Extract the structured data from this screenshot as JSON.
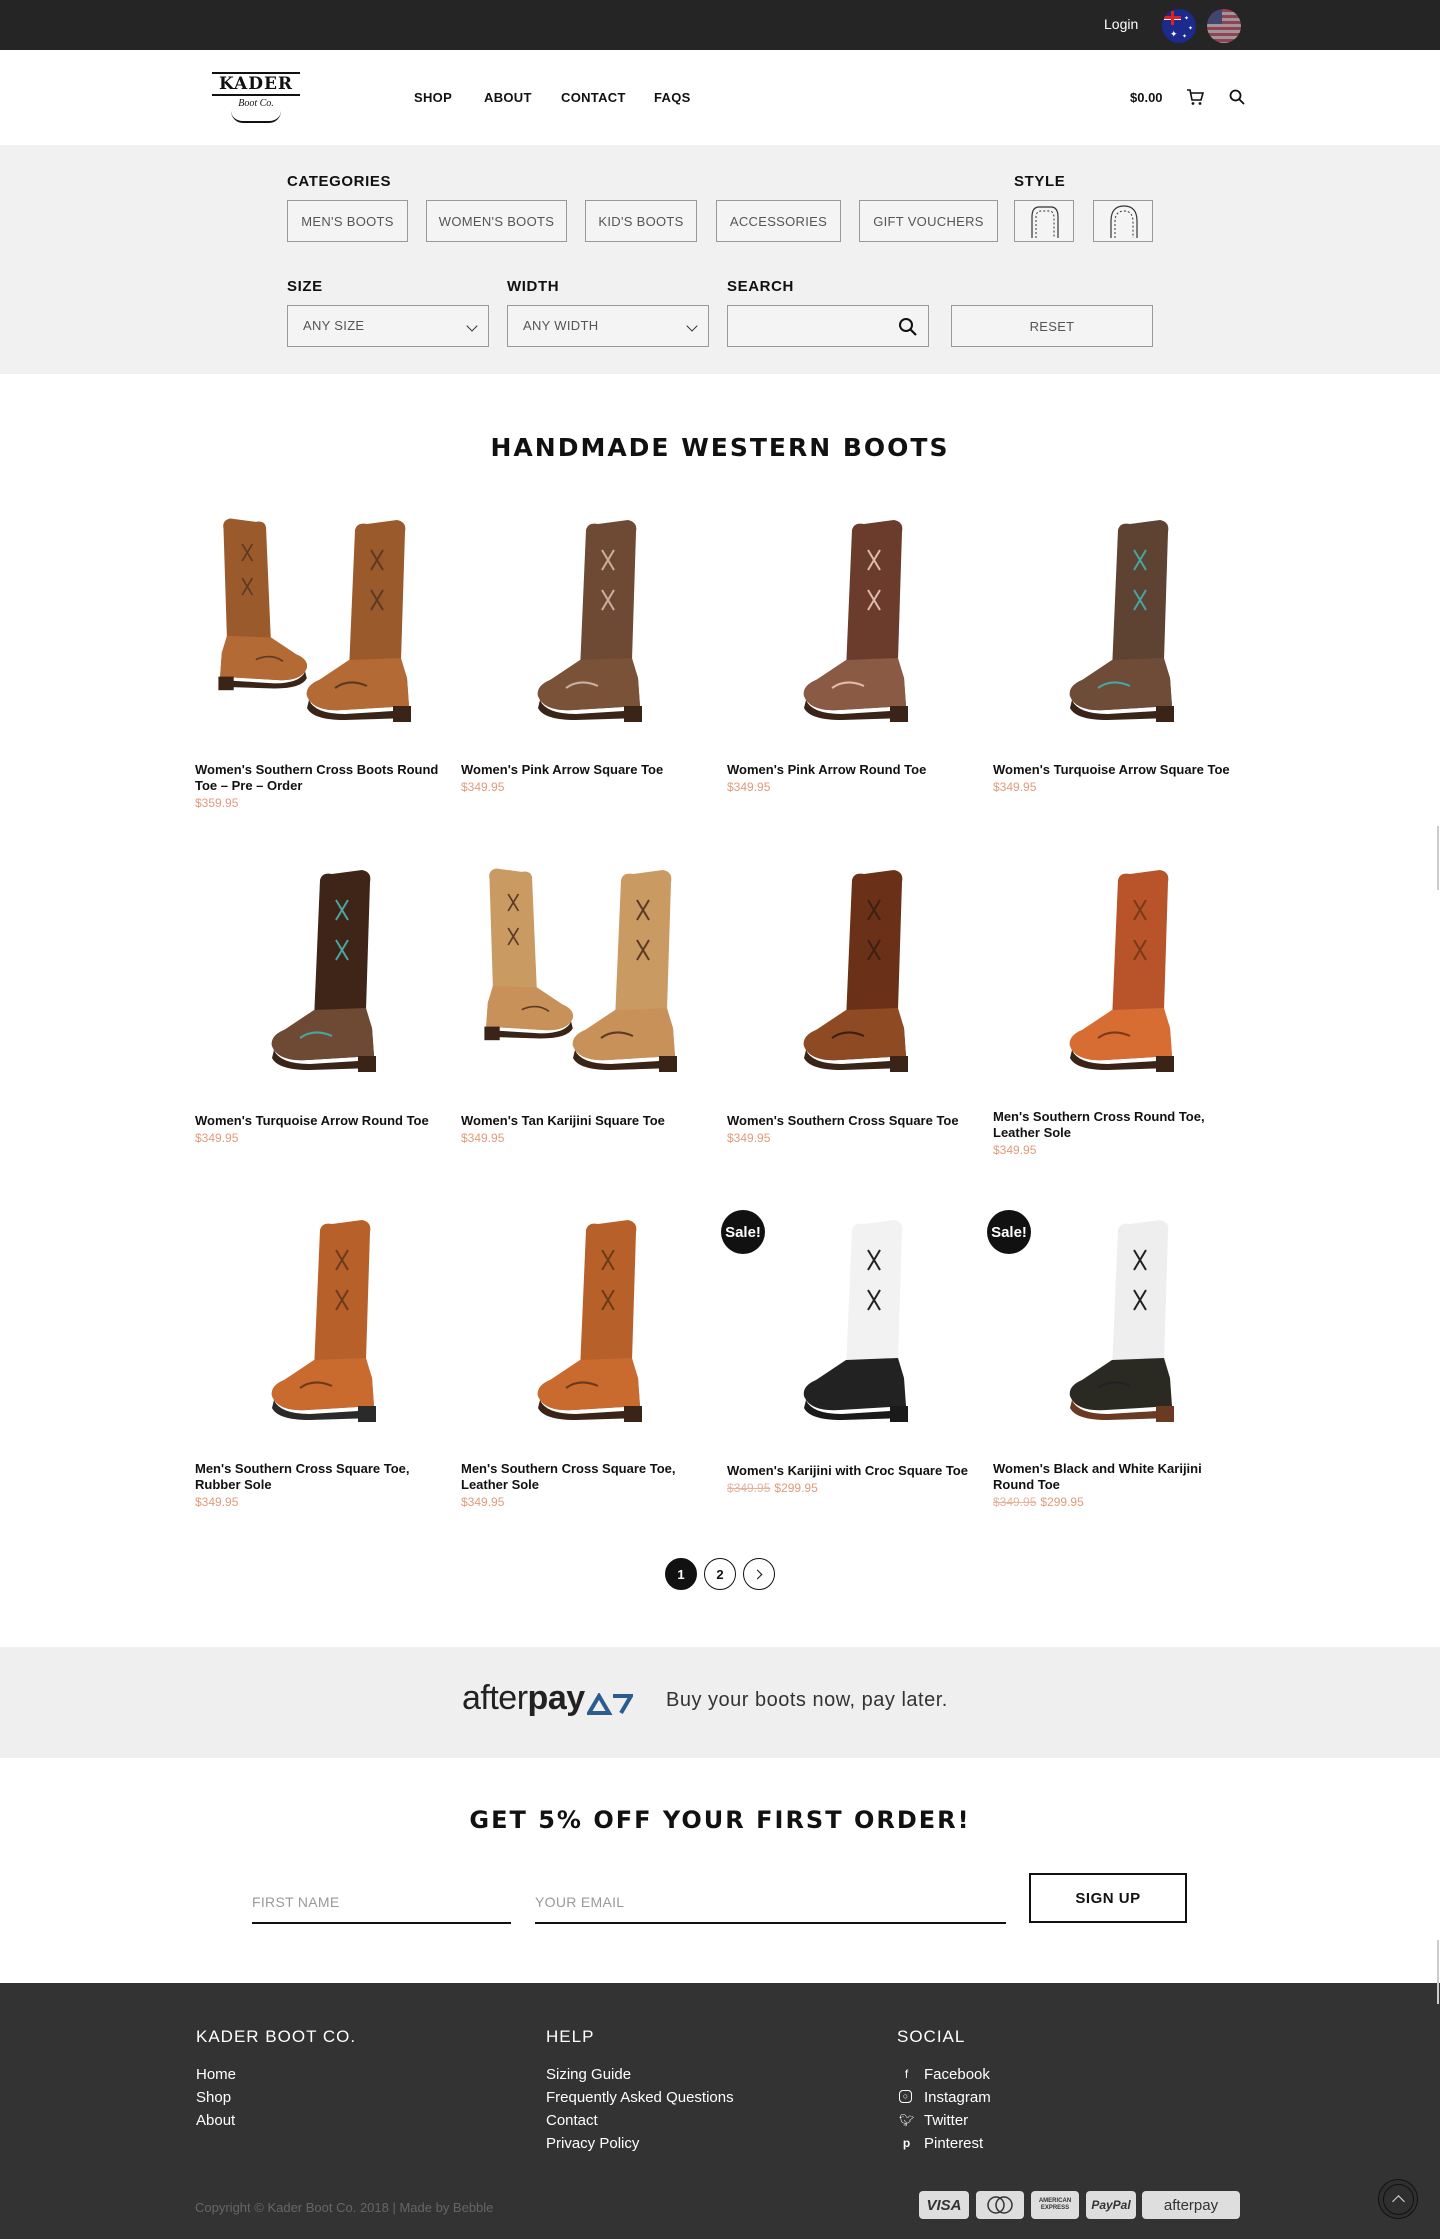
{
  "topbar": {
    "login_label": "Login",
    "flags": [
      "australia-flag",
      "usa-flag"
    ]
  },
  "header": {
    "logo_line1": "KADER",
    "logo_line2": "Boot Co.",
    "nav": [
      "SHOP",
      "ABOUT",
      "CONTACT",
      "FAQS"
    ],
    "cart_total": "$0.00"
  },
  "filters": {
    "categories_label": "CATEGORIES",
    "categories": [
      "MEN'S BOOTS",
      "WOMEN'S BOOTS",
      "KID'S BOOTS",
      "ACCESSORIES",
      "GIFT VOUCHERS"
    ],
    "style_label": "STYLE",
    "style_options": [
      "square-toe-icon",
      "round-toe-icon"
    ],
    "size_label": "SIZE",
    "size_value": "ANY SIZE",
    "width_label": "WIDTH",
    "width_value": "ANY WIDTH",
    "search_label": "SEARCH",
    "search_placeholder": "",
    "reset_label": "RESET"
  },
  "products": {
    "title": "HANDMADE WESTERN BOOTS",
    "sale_label": "Sale!",
    "items": [
      {
        "name": "Women's Southern Cross Boots Round Toe – Pre – Order",
        "price": "$359.95",
        "old_price": ""
      },
      {
        "name": "Women's Pink Arrow Square Toe",
        "price": "$349.95",
        "old_price": ""
      },
      {
        "name": "Women's Pink Arrow Round Toe",
        "price": "$349.95",
        "old_price": ""
      },
      {
        "name": "Women's Turquoise Arrow Square Toe",
        "price": "$349.95",
        "old_price": ""
      },
      {
        "name": "Women's Turquoise Arrow Round Toe",
        "price": "$349.95",
        "old_price": ""
      },
      {
        "name": "Women's Tan Karijini Square Toe",
        "price": "$349.95",
        "old_price": ""
      },
      {
        "name": "Women's Southern Cross Square Toe",
        "price": "$349.95",
        "old_price": ""
      },
      {
        "name": "Men's Southern Cross Round Toe, Leather Sole",
        "price": "$349.95",
        "old_price": ""
      },
      {
        "name": "Men's Southern Cross Square Toe, Rubber Sole",
        "price": "$349.95",
        "old_price": ""
      },
      {
        "name": "Men's Southern Cross Square Toe, Leather Sole",
        "price": "$349.95",
        "old_price": ""
      },
      {
        "name": "Women's Karijini with Croc Square Toe",
        "price": "$299.95",
        "old_price": "$349.95"
      },
      {
        "name": "Women's Black and White Karijini Round Toe",
        "price": "$299.95",
        "old_price": "$349.95"
      }
    ]
  },
  "pagination": {
    "pages": [
      "1",
      "2"
    ],
    "current": "1"
  },
  "afterpay": {
    "logo_text_light": "after",
    "logo_text_bold": "pay",
    "tagline": "Buy your boots now, pay later."
  },
  "newsletter": {
    "title": "GET 5% OFF YOUR FIRST ORDER!",
    "first_name_placeholder": "FIRST NAME",
    "email_placeholder": "YOUR EMAIL",
    "signup_label": "SIGN UP"
  },
  "footer": {
    "col1_title": "KADER BOOT CO.",
    "col1_links": [
      "Home",
      "Shop",
      "About"
    ],
    "col2_title": "HELP",
    "col2_links": [
      "Sizing Guide",
      "Frequently Asked Questions",
      "Contact",
      "Privacy Policy"
    ],
    "col3_title": "SOCIAL",
    "col3_links": [
      "Facebook",
      "Instagram",
      "Twitter",
      "Pinterest"
    ],
    "copyright": "Copyright © Kader Boot Co. 2018 | Made by Bebble",
    "payments": [
      "VISA",
      "MasterCard",
      "AMERICAN EXPRESS",
      "PayPal",
      "afterpay"
    ]
  },
  "colors": {
    "price": "#e29a7a",
    "footer_bg": "#333333",
    "topbar_bg": "#252525",
    "filter_bg": "#f1f1f1"
  }
}
